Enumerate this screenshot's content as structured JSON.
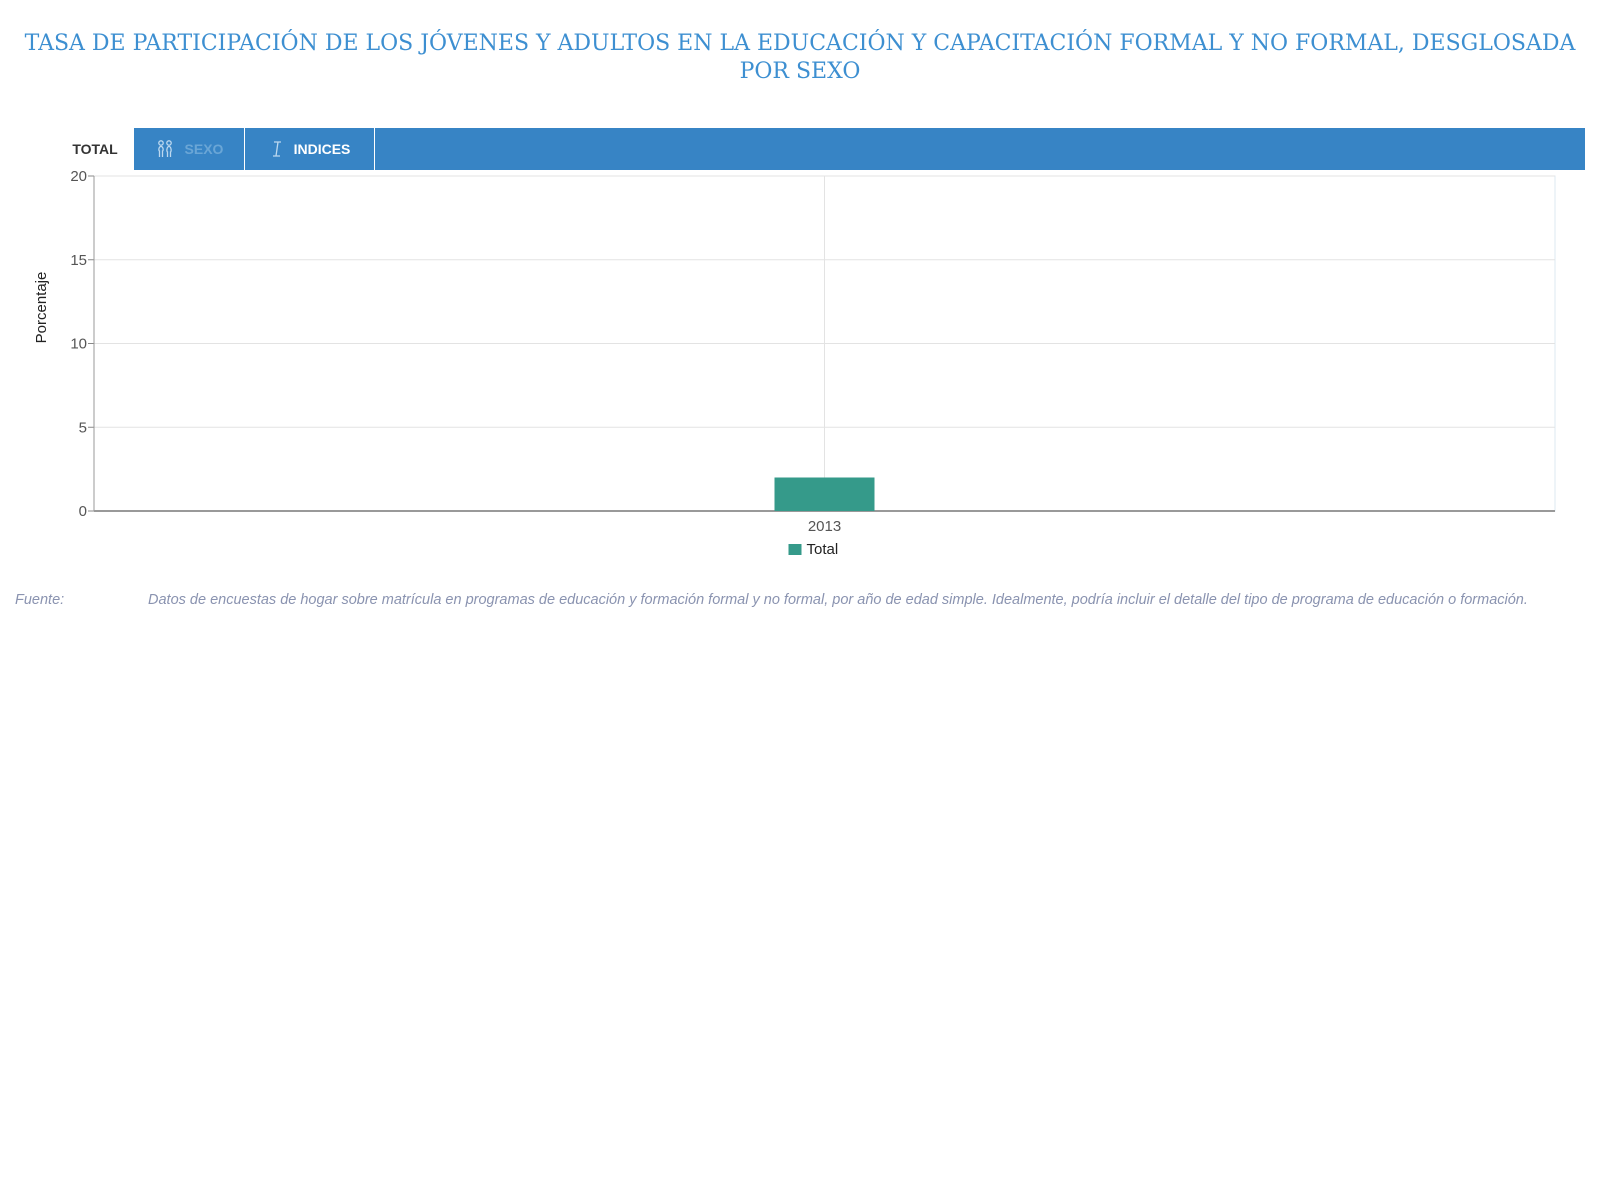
{
  "page": {
    "title": "TASA DE PARTICIPACIÓN DE LOS JÓVENES Y ADULTOS EN LA EDUCACIÓN Y CAPACITACIÓN FORMAL Y NO FORMAL, DESGLOSADA POR SEXO"
  },
  "tabs": {
    "total": "TOTAL",
    "sexo": "SEXO",
    "indices": "INDICES",
    "sexo_icon": "gender-icon",
    "indices_icon": "index-icon"
  },
  "colors": {
    "title": "#3d8fd1",
    "tabbar": "#3784c5",
    "bar": "#359a8a"
  },
  "chart_data": {
    "type": "bar",
    "categories": [
      "2013"
    ],
    "series": [
      {
        "name": "Total",
        "values": [
          2
        ]
      }
    ],
    "ylabel": "Porcentaje",
    "ylim": [
      0,
      20
    ],
    "yticks": [
      0,
      5,
      10,
      15,
      20
    ],
    "grid": true,
    "legend": "bottom-center"
  },
  "source": {
    "label": "Fuente:",
    "text": "Datos de encuestas de hogar sobre matrícula en programas de educación y formación formal y no formal, por año de edad simple. Idealmente, podría incluir el detalle del tipo de programa de educación o formación."
  }
}
